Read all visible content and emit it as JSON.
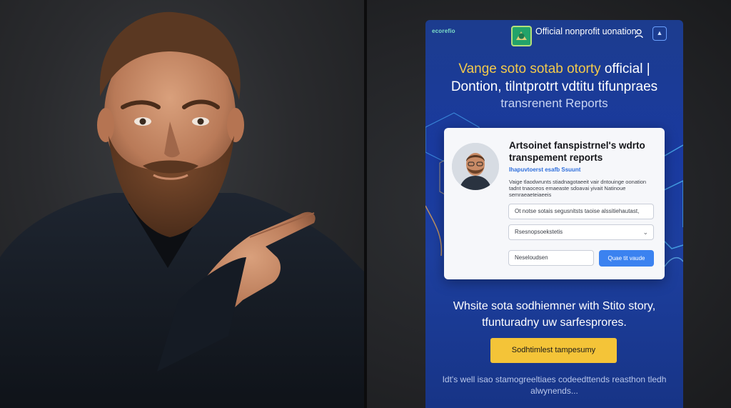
{
  "phone": {
    "tiny_brand": "ecorefio",
    "org_name": "Official nonprofit uonation",
    "account_icon": "user-icon",
    "menu_icon": "bars-icon",
    "hero_title_highlight": "Vange soto sotab otorty",
    "hero_title_rest": " official |",
    "hero_title_line2": "Dontion, tilntprotrt vdtitu tifunpraes",
    "hero_subtitle": "transrenent Reports",
    "card": {
      "title": "Artsoinet fanspistrnel's wdrto transpement reports",
      "link": "Ihapuvtoerst esafb Ssuunt",
      "body": "Vaige tlaodwrunts stiadnagotaeeit vair dntouinge oonation tadnt tnaoceos emaeaste sdoavai yivait Natinoue semraeaeteiaeeis",
      "search_placeholder": "Ot notse sotais segusnitsts taoise alssitiehautast,",
      "select_value": "Rsesnopsoekstetis",
      "amount_placeholder": "Neseloudsen",
      "give_button": "Quae tit vaude"
    },
    "story_text": "Whsite sota sodhiemner with Stito story, tfunturadny uw sarfesprores.",
    "cta_button": "Sodhtimlest tampesumy",
    "footer_note": "Idt's well isao stamogreeltiaes codeedttends reasthon tledh alwynends..."
  },
  "colors": {
    "page_bg": "#1c3c8e",
    "accent_yellow": "#f2c94c",
    "cta_yellow": "#f4c438",
    "button_blue": "#3b82f0",
    "logo_green": "#23a36a"
  }
}
